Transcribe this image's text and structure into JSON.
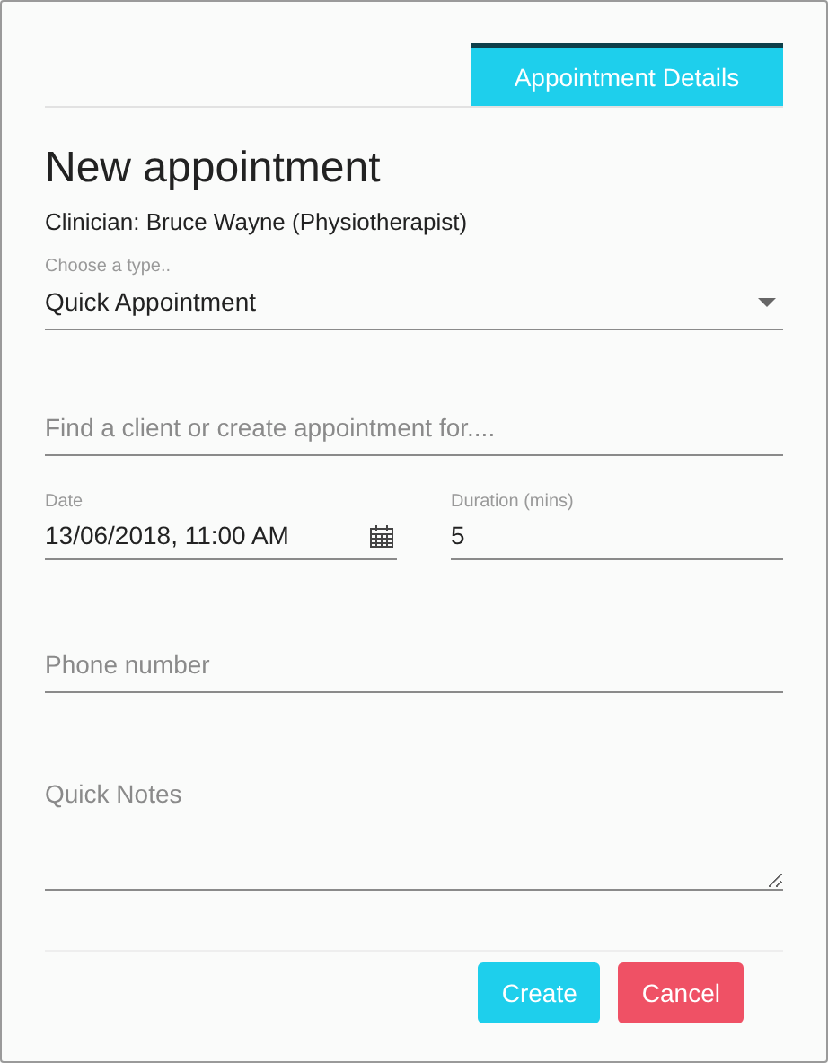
{
  "tabs": [
    {
      "label": "Appointment Details",
      "selected": true
    }
  ],
  "title": "New appointment",
  "clinician": "Clinician: Bruce Wayne (Physiotherapist)",
  "type_select": {
    "label": "Choose a type..",
    "value": "Quick Appointment"
  },
  "client_field": {
    "placeholder": "Find a client or create appointment for...."
  },
  "date_field": {
    "label": "Date",
    "value": "13/06/2018, 11:00 AM"
  },
  "duration_field": {
    "label": "Duration (mins)",
    "value": "5"
  },
  "phone_field": {
    "placeholder": "Phone number"
  },
  "notes_field": {
    "placeholder": "Quick Notes"
  },
  "buttons": [
    {
      "label": "Create",
      "kind": "primary"
    },
    {
      "label": "Cancel",
      "kind": "danger"
    }
  ]
}
